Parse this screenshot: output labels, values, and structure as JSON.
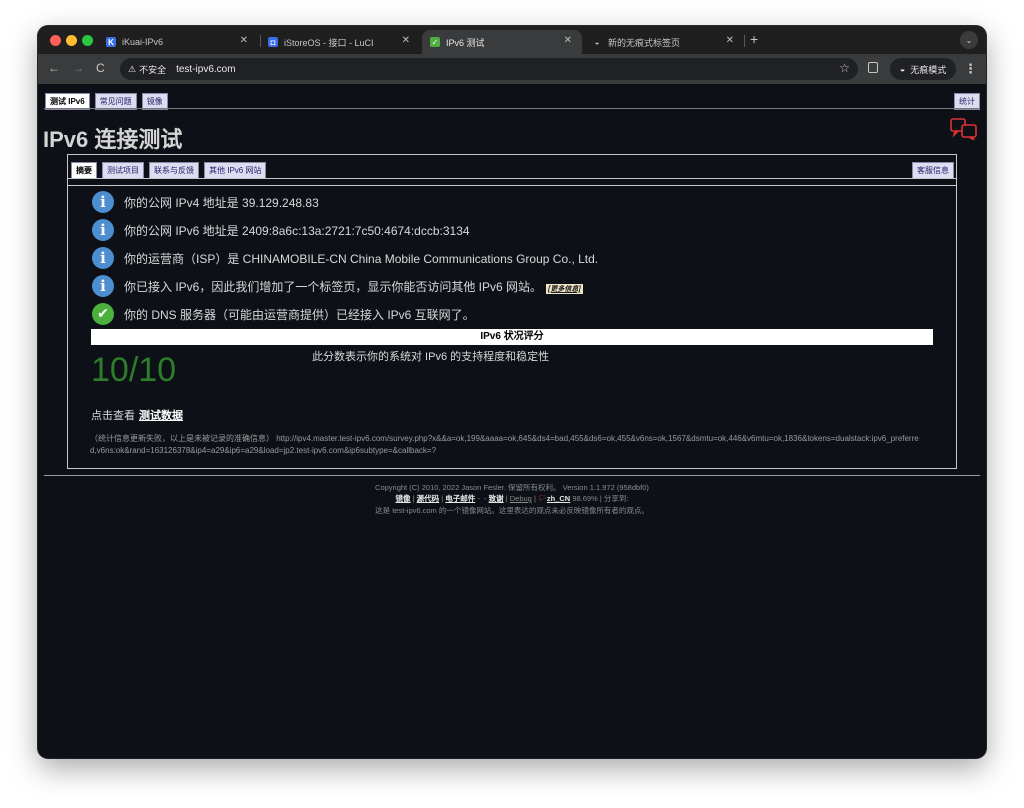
{
  "browser": {
    "tabs": [
      {
        "title": "iKuai-IPv6",
        "favicon": "ikuai-icon",
        "color": "#3b6ee6",
        "active": false
      },
      {
        "title": "iStoreOS - 接口 - LuCI",
        "favicon": "istoreos-icon",
        "color": "#3b6ee6",
        "active": false
      },
      {
        "title": "IPv6 测试",
        "favicon": "ipv6-check-icon",
        "color": "#4caf3e",
        "active": true
      },
      {
        "title": "新的无痕式标签页",
        "favicon": "incognito-icon",
        "color": "#888888",
        "active": false
      }
    ],
    "security_label": "不安全",
    "url": "test-ipv6.com",
    "incognito_label": "无痕模式"
  },
  "page": {
    "top_nav": [
      "测试 IPv6",
      "常见问题",
      "镜像"
    ],
    "stats_label": "统计",
    "title": "IPv6 连接测试",
    "sub_nav": [
      "摘要",
      "测试项目",
      "联系与反馈",
      "其他 IPv6 网站"
    ],
    "support_label": "客服信息",
    "messages": [
      {
        "icon": "info",
        "text": "你的公网 IPv4 地址是 39.129.248.83"
      },
      {
        "icon": "info",
        "text": "你的公网 IPv6 地址是 2409:8a6c:13a:2721:7c50:4674:dccb:3134"
      },
      {
        "icon": "info",
        "text": "你的运营商（ISP）是 CHINAMOBILE-CN China Mobile Communications Group Co., Ltd."
      },
      {
        "icon": "info",
        "text": "你已接入 IPv6，因此我们增加了一个标签页，显示你能否访问其他 IPv6 网站。"
      },
      {
        "icon": "ok",
        "text": "你的 DNS 服务器（可能由运营商提供）已经接入 IPv6 互联网了。"
      }
    ],
    "more_info_label": "[更多信息]",
    "score_header": "IPv6 状况评分",
    "score": "10/10",
    "score_desc": "此分数表示你的系统对 IPv6 的支持程度和稳定性",
    "click_prefix": "点击查看",
    "test_data_link": "测试数据",
    "survey_text": "（统计信息更新失败，以上是未被记录的准确信息） http://ipv4.master.test-ipv6.com/survey.php?x&&a=ok,199&aaaa=ok,645&ds4=bad,455&ds6=ok,455&v6ns=ok,1567&dsmtu=ok,446&v6mtu=ok,1836&tokens=dualstack:ipv6_preferred,v6ns:ok&rand=163126378&ip4=a29&ip6=a29&load=jp2.test-ipv6.com&ip6subtype=&callback=?"
  },
  "footer": {
    "copyright": "Copyright (C) 2010, 2022 Jason Fesler. 保留所有权利。 Version 1.1.972 (958dbf0)",
    "mirrors": "镜像",
    "source": "源代码",
    "email": "电子邮件",
    "email_suffix": " -",
    "thanks_prefix": "- ",
    "thanks": "致谢",
    "debug": "Debug",
    "locale_flag": "🏳",
    "locale": "zh_CN",
    "locale_pct": "98.69%",
    "share": "分享到:",
    "mirror_note": "这是 test-ipv6.com 的一个镜像网站。这里表达的观点未必反映镜像所有者的观点。"
  }
}
